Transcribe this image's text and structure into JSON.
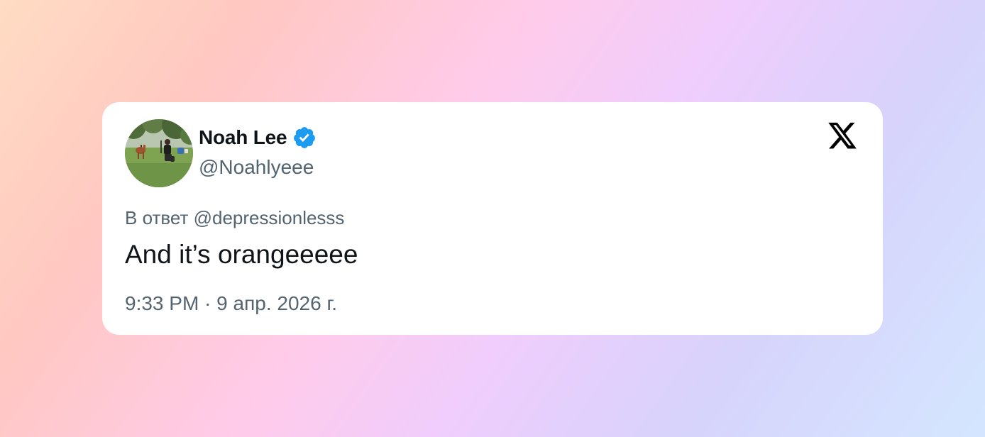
{
  "tweet": {
    "author": {
      "display_name": "Noah Lee",
      "handle": "@Noahlyeee",
      "verified": true,
      "verified_icon": "verified-badge-icon",
      "avatar": "profile-photo"
    },
    "platform_icon": "x-logo-icon",
    "reply_context": "В ответ @depressionlesss",
    "text": "And it’s orangeeeee",
    "timestamp": "9:33 PM · 9 апр. 2026 г."
  },
  "colors": {
    "card_background": "#ffffff",
    "primary_text": "#0f1419",
    "secondary_text": "#536471",
    "verified_blue": "#1d9bf0"
  }
}
